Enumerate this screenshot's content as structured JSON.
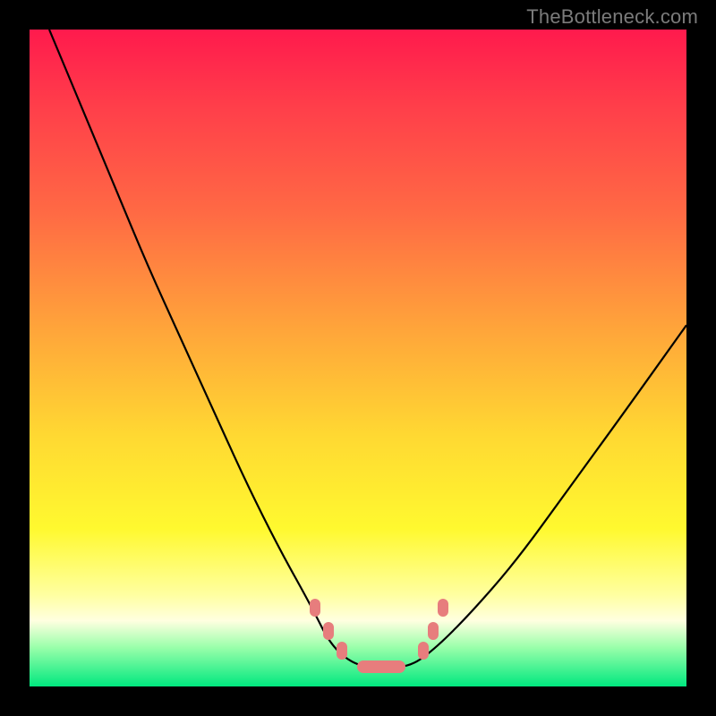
{
  "watermark": "TheBottleneck.com",
  "colors": {
    "frame": "#000000",
    "curve": "#000000",
    "marker": "#e77d7d",
    "gradient_top": "#ff1a4d",
    "gradient_bottom": "#00e87f"
  },
  "chart_data": {
    "type": "line",
    "title": "",
    "xlabel": "",
    "ylabel": "",
    "xlim": [
      0,
      1
    ],
    "ylim": [
      0,
      1
    ],
    "note": "Axes are unlabeled; values normalized 0..1 (left/bottom = 0). Y is bottleneck-like quantity where 0 (bottom, green) is optimal and 1 (top, red) is worst. Curve is a V/U shape with a flat minimum near x≈0.50–0.57.",
    "series": [
      {
        "name": "curve",
        "x": [
          0.03,
          0.08,
          0.13,
          0.18,
          0.23,
          0.28,
          0.33,
          0.38,
          0.43,
          0.46,
          0.5,
          0.54,
          0.58,
          0.62,
          0.67,
          0.74,
          0.82,
          0.9,
          1.0
        ],
        "y": [
          1.0,
          0.88,
          0.76,
          0.64,
          0.53,
          0.42,
          0.31,
          0.21,
          0.12,
          0.06,
          0.03,
          0.03,
          0.03,
          0.06,
          0.11,
          0.19,
          0.3,
          0.41,
          0.55
        ]
      }
    ],
    "markers": {
      "description": "Salmon oval markers along the curve near the minimum",
      "points": [
        {
          "x": 0.435,
          "y": 0.12
        },
        {
          "x": 0.455,
          "y": 0.085
        },
        {
          "x": 0.475,
          "y": 0.055
        },
        {
          "x": 0.535,
          "y": 0.03,
          "shape": "wide"
        },
        {
          "x": 0.6,
          "y": 0.055
        },
        {
          "x": 0.615,
          "y": 0.085
        },
        {
          "x": 0.63,
          "y": 0.12
        }
      ]
    }
  }
}
